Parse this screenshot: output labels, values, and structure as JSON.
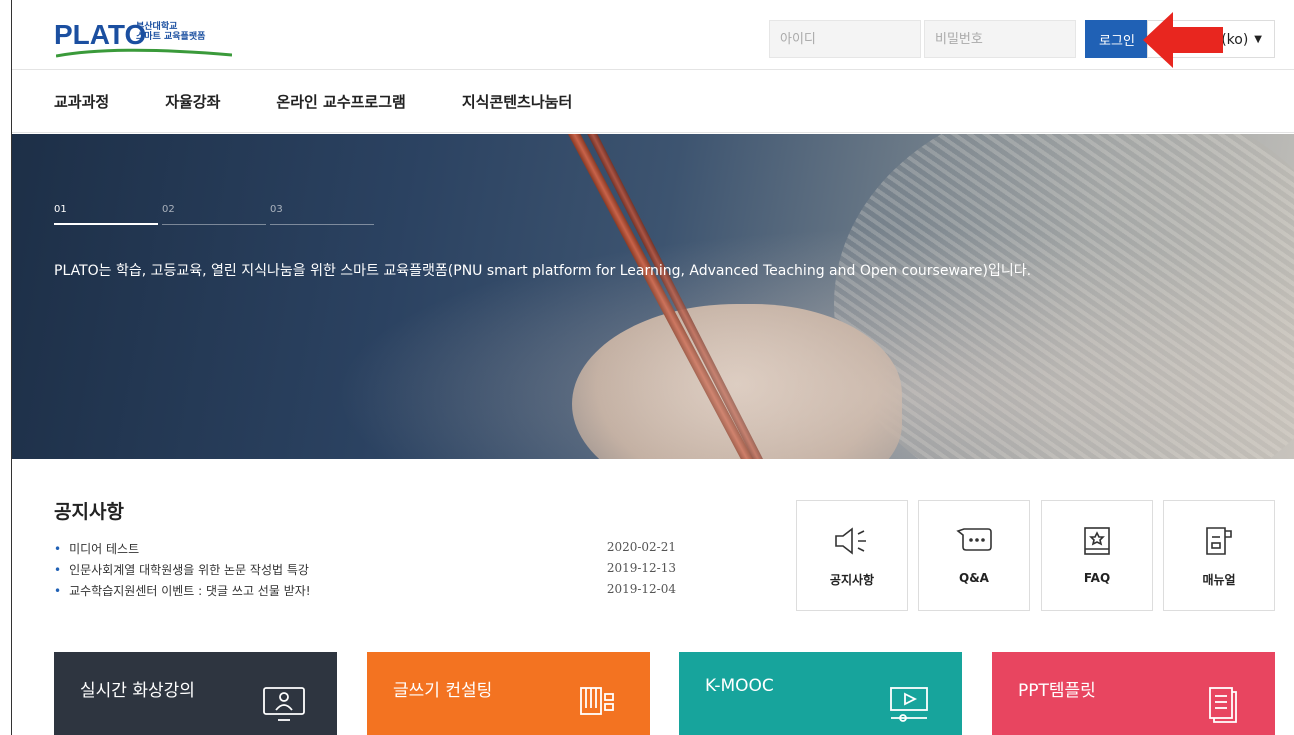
{
  "header": {
    "logo_text": "PLATO",
    "logo_sub_line1": "부산대학교",
    "logo_sub_line2": "스마트 교육플랫폼",
    "id_placeholder": "아이디",
    "pw_placeholder": "비밀번호",
    "login_label": "로그인",
    "language_label": "국어 (ko)"
  },
  "nav": {
    "items": [
      {
        "label": "교과과정"
      },
      {
        "label": "자율강좌"
      },
      {
        "label": "온라인 교수프로그램"
      },
      {
        "label": "지식콘텐츠나눔터"
      }
    ]
  },
  "hero": {
    "indicators": [
      {
        "label": "01",
        "active": true
      },
      {
        "label": "02",
        "active": false
      },
      {
        "label": "03",
        "active": false
      }
    ],
    "text": "PLATO는 학습, 고등교육, 열린 지식나눔을 위한 스마트 교육플랫폼(PNU smart platform for Learning, Advanced Teaching and Open courseware)입니다."
  },
  "notices": {
    "title": "공지사항",
    "items": [
      {
        "title": "미디어 테스트",
        "date": "2020-02-21"
      },
      {
        "title": "인문사회계열 대학원생을 위한 논문 작성법 특강",
        "date": "2019-12-13"
      },
      {
        "title": "교수학습지원센터 이벤트 : 댓글 쓰고 선물 받자!",
        "date": "2019-12-04"
      }
    ]
  },
  "quick_links": [
    {
      "label": "공지사항",
      "icon": "megaphone-icon"
    },
    {
      "label": "Q&A",
      "icon": "chat-bubble-icon"
    },
    {
      "label": "FAQ",
      "icon": "book-star-icon"
    },
    {
      "label": "매뉴얼",
      "icon": "manual-icon"
    }
  ],
  "tiles": [
    {
      "label": "실시간 화상강의",
      "color": "#2e3540",
      "icon": "monitor-user-icon"
    },
    {
      "label": "글쓰기 컨설팅",
      "color": "#f37321",
      "icon": "pencil-doc-icon"
    },
    {
      "label": "K-MOOC",
      "color": "#17a49c",
      "icon": "video-play-icon"
    },
    {
      "label": "PPT템플릿",
      "color": "#e84560",
      "icon": "document-stack-icon"
    }
  ],
  "colors": {
    "brand_blue": "#2061b5",
    "arrow_red": "#e8261f"
  }
}
